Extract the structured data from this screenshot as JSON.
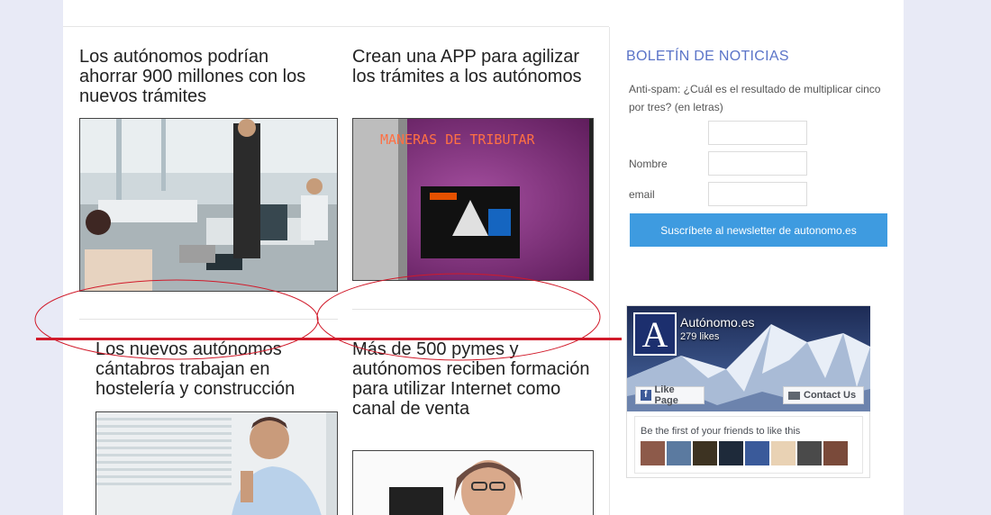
{
  "articles": [
    {
      "title": "Los autónomos podrían ahorrar 900 millones con los nuevos trámites"
    },
    {
      "title": "Crean una APP para agilizar los trámites a los autónomos",
      "image_caption": "MANERAS DE TRIBUTAR"
    },
    {
      "title": "Los nuevos autónomos cántabros trabajan en hostelería y construcción"
    },
    {
      "title": "Más de 500 pymes y autónomos reciben formación para utilizar Internet como canal de venta"
    }
  ],
  "newsletter": {
    "heading": "BOLETÍN DE NOTICIAS",
    "antispam_label": "Anti-spam: ¿Cuál es el resultado de multiplicar cinco por tres? (en letras)",
    "name_label": "Nombre",
    "email_label": "email",
    "subscribe_label": "Suscríbete al newsletter de autonomo.es"
  },
  "facebook": {
    "logo_letter": "A",
    "page_name": "Autónomo.es",
    "likes": "279 likes",
    "like_button": "Like Page",
    "contact_button": "Contact Us",
    "friends_text": "Be the first of your friends to like this"
  },
  "colors": {
    "accent": "#3e9be0",
    "heading": "#5b74c8",
    "annotation": "#d11a2a"
  }
}
